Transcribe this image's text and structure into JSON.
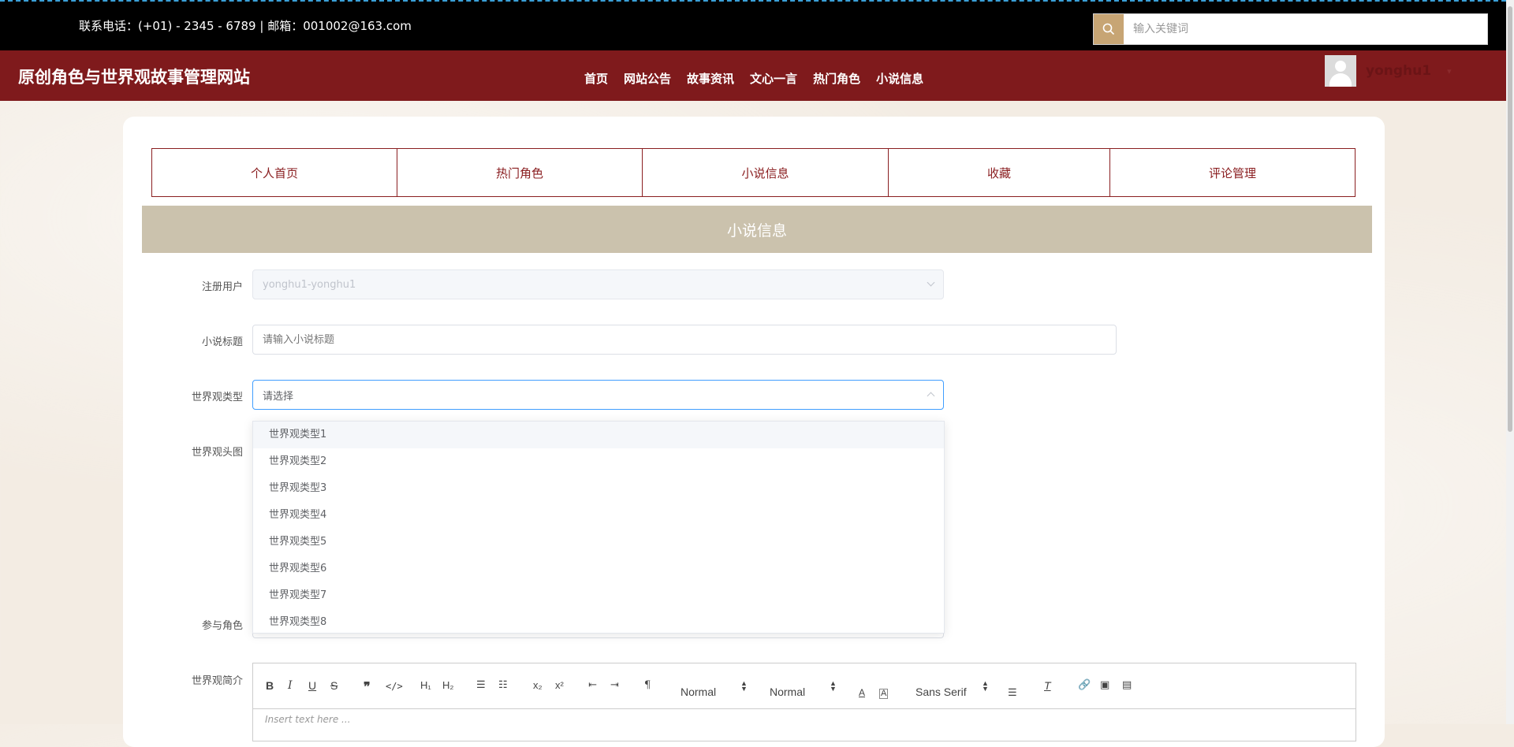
{
  "topbar": {
    "contact": "联系电话：(+01) - 2345 - 6789 | 邮箱：001002@163.com",
    "search_placeholder": "输入关键词"
  },
  "header": {
    "site_title": "原创角色与世界观故事管理网站",
    "nav": [
      "首页",
      "网站公告",
      "故事资讯",
      "文心一言",
      "热门角色",
      "小说信息"
    ],
    "username": "yonghu1"
  },
  "tabs": [
    "个人首页",
    "热门角色",
    "小说信息",
    "收藏",
    "评论管理"
  ],
  "section_title": "小说信息",
  "form": {
    "user_label": "注册用户",
    "user_value": "yonghu1-yonghu1",
    "title_label": "小说标题",
    "title_placeholder": "请输入小说标题",
    "type_label": "世界观类型",
    "type_placeholder": "请选择",
    "image_label": "世界观头图",
    "roles_label": "参与角色",
    "intro_label": "世界观简介",
    "type_options": [
      "世界观类型1",
      "世界观类型2",
      "世界观类型3",
      "世界观类型4",
      "世界观类型5",
      "世界观类型6",
      "世界观类型7",
      "世界观类型8"
    ]
  },
  "editor": {
    "header_select": "Normal",
    "size_select": "Normal",
    "font_select": "Sans Serif",
    "placeholder": "Insert text here ..."
  },
  "colors": {
    "topbar": "#000000",
    "header": "#7f1a1c",
    "accent": "#8a1e20",
    "section": "#cbc2ad",
    "search_button": "#c7a574"
  }
}
